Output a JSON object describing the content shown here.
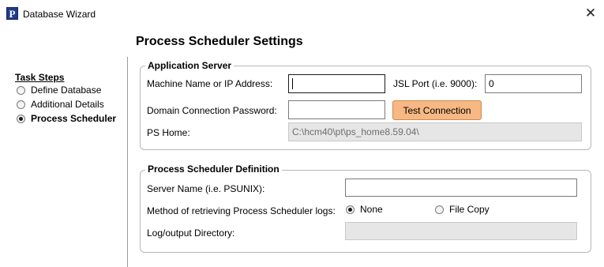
{
  "window": {
    "title": "Database Wizard",
    "icon": "peoplesoft-app-icon",
    "close_symbol": "✕"
  },
  "page": {
    "title": "Process Scheduler Settings"
  },
  "task_steps": {
    "heading": "Task Steps",
    "items": [
      {
        "label": "Define Database",
        "selected": false
      },
      {
        "label": "Additional Details",
        "selected": false
      },
      {
        "label": "Process Scheduler",
        "selected": true
      }
    ]
  },
  "app_server": {
    "legend": "Application Server",
    "machine_label": "Machine Name or IP Address:",
    "machine_value": "",
    "jsl_label": "JSL Port (i.e. 9000):",
    "jsl_value": "0",
    "domain_pw_label": "Domain Connection Password:",
    "domain_pw_value": "",
    "test_button": "Test Connection",
    "ps_home_label": "PS Home:",
    "ps_home_value": "C:\\hcm40\\pt\\ps_home8.59.04\\"
  },
  "ps_definition": {
    "legend": "Process Scheduler Definition",
    "server_name_label": "Server Name (i.e. PSUNIX):",
    "server_name_value": "",
    "method_label": "Method of retrieving Process Scheduler logs:",
    "options": [
      {
        "label": "None",
        "selected": true
      },
      {
        "label": "File Copy",
        "selected": false
      }
    ],
    "log_dir_label": "Log/output Directory:",
    "log_dir_value": ""
  },
  "colors": {
    "accent_button": "#f7b883",
    "app_icon": "#1f3c8a"
  }
}
